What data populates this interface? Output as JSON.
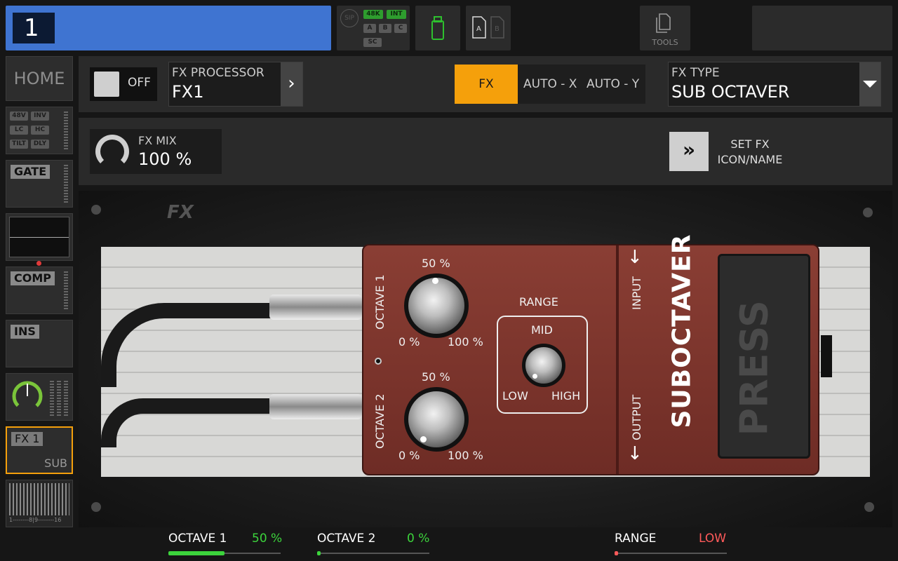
{
  "top_bar": {
    "channel_number": "1",
    "status": {
      "sip": "SIP",
      "rate": "48K",
      "clock": "INT",
      "a": "A",
      "b": "B",
      "c": "C",
      "sc": "SC"
    },
    "card_a": "A",
    "card_b": "B",
    "tools_label": "TOOLS",
    "colors": {
      "channel": "#3f74d1",
      "active": "#2e9d2e"
    }
  },
  "sidebar": {
    "home": "HOME",
    "input_tags": [
      "48V",
      "INV",
      "LC",
      "HC",
      "TILT",
      "DLY"
    ],
    "gate": "GATE",
    "comp": "COMP",
    "ins": "INS",
    "fx1_label": "FX 1",
    "fx1_sub": "SUB",
    "bus_scale": "1--------8|9--------16"
  },
  "fx_header": {
    "onoff_label": "OFF",
    "processor_title": "FX PROCESSOR",
    "processor_value": "FX1",
    "modes": [
      "FX",
      "AUTO - X",
      "AUTO - Y"
    ],
    "active_mode": "FX",
    "fx_type_title": "FX TYPE",
    "fx_type_value": "SUB OCTAVER",
    "colors": {
      "active_mode": "#f5a00b"
    }
  },
  "fx_mix": {
    "title": "FX MIX",
    "value": "100 %",
    "set_fx_line1": "SET FX",
    "set_fx_line2": "ICON/NAME"
  },
  "pedal": {
    "fx_logo": "FX",
    "brand": "SUBOCTAVER",
    "press": "PRESS",
    "input": "INPUT",
    "output": "OUTPUT",
    "octave1": {
      "label": "OCTAVE 1",
      "top": "50 %",
      "min": "0 %",
      "max": "100 %"
    },
    "octave2": {
      "label": "OCTAVE 2",
      "top": "50 %",
      "min": "0 %",
      "max": "100 %"
    },
    "range": {
      "label": "RANGE",
      "mid": "MID",
      "low": "LOW",
      "high": "HIGH"
    }
  },
  "bottom_bar": {
    "params": [
      {
        "label": "OCTAVE 1",
        "value": "50 %",
        "level": 0.5,
        "color": "#3cd43c"
      },
      {
        "label": "OCTAVE 2",
        "value": "0 %",
        "level": 0.0,
        "color": "#3cd43c"
      },
      {
        "label": "RANGE",
        "value": "LOW",
        "level": 0.0,
        "color": "#ff5a5a"
      }
    ]
  }
}
